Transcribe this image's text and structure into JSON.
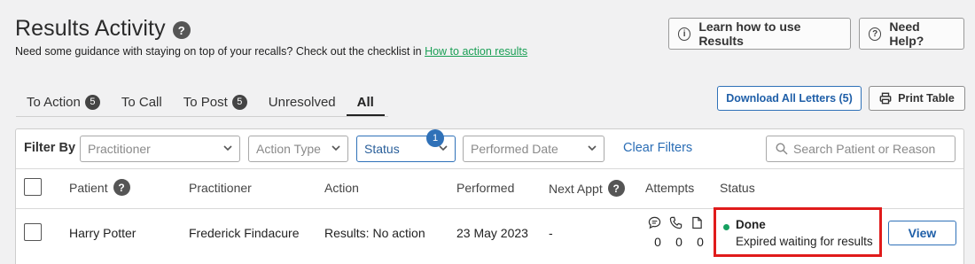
{
  "header": {
    "title": "Results Activity",
    "help_glyph": "?",
    "subtitle": "Need some guidance with staying on top of your recalls? Check out the checklist in",
    "subtitle_link": "How to action results",
    "learn_button": "Learn how to use Results",
    "help_button": "Need Help?"
  },
  "tabs": [
    {
      "label": "To Action",
      "count": "5",
      "active": false
    },
    {
      "label": "To Call",
      "count": "",
      "active": false
    },
    {
      "label": "To Post",
      "count": "5",
      "active": false
    },
    {
      "label": "Unresolved",
      "count": "",
      "active": false
    },
    {
      "label": "All",
      "count": "",
      "active": true
    }
  ],
  "actions": {
    "download_letters": "Download All Letters (5)",
    "print_table": "Print Table"
  },
  "filters": {
    "label": "Filter By",
    "practitioner_placeholder": "Practitioner",
    "action_type_placeholder": "Action Type",
    "status_placeholder": "Status",
    "status_count": "1",
    "performed_date_placeholder": "Performed Date",
    "clear": "Clear Filters",
    "search_placeholder": "Search Patient or Reason"
  },
  "table": {
    "columns": {
      "patient": "Patient",
      "practitioner": "Practitioner",
      "action": "Action",
      "performed": "Performed",
      "next_appt": "Next Appt",
      "attempts": "Attempts",
      "status": "Status"
    },
    "rows": [
      {
        "patient": "Harry Potter",
        "practitioner": "Frederick Findacure",
        "action": "Results: No action",
        "performed": "23 May 2023",
        "next_appt": "-",
        "attempts": {
          "sms": "0",
          "call": "0",
          "letter": "0"
        },
        "status": "Done",
        "status_detail": "Expired waiting for results",
        "view": "View"
      }
    ]
  },
  "colors": {
    "accent_blue": "#2f71b8",
    "link_green": "#1a9f55",
    "status_done": "#16a060",
    "highlight_red": "#e01b1b"
  },
  "icons": [
    "help-icon",
    "info-icon",
    "question-icon",
    "printer-icon",
    "chevron-down-icon",
    "search-icon",
    "message-icon",
    "phone-icon",
    "letter-icon"
  ]
}
